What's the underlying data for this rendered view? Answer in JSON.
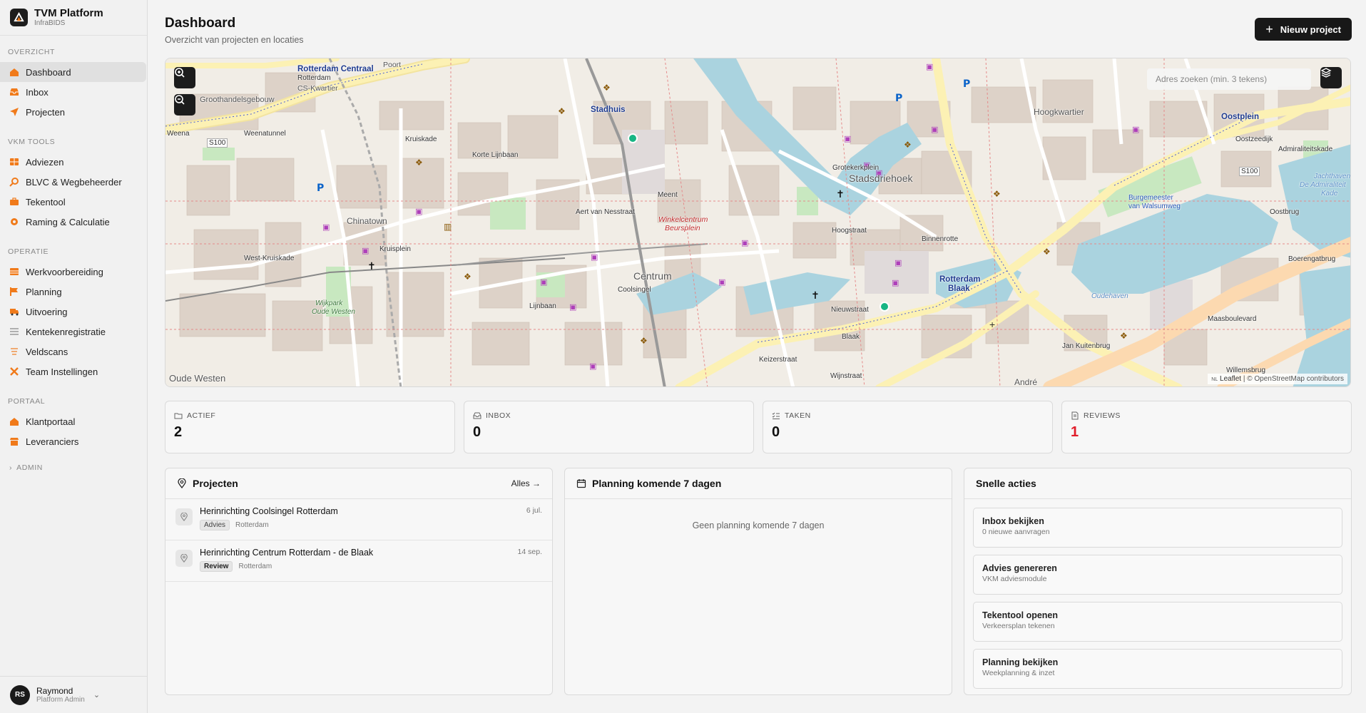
{
  "brand": {
    "title": "TVM Platform",
    "subtitle": "InfraBIDS"
  },
  "sidebar": {
    "sections": [
      {
        "header": "OVERZICHT",
        "items": [
          {
            "label": "Dashboard",
            "icon": "home-icon",
            "active": true
          },
          {
            "label": "Inbox",
            "icon": "inbox-icon"
          },
          {
            "label": "Projecten",
            "icon": "send-icon"
          }
        ]
      },
      {
        "header": "VKM TOOLS",
        "items": [
          {
            "label": "Adviezen",
            "icon": "grid-icon"
          },
          {
            "label": "BLVC & Wegbeheerder",
            "icon": "search-icon"
          },
          {
            "label": "Tekentool",
            "icon": "briefcase-icon"
          },
          {
            "label": "Raming & Calculatie",
            "icon": "gear-icon"
          }
        ]
      },
      {
        "header": "OPERATIE",
        "items": [
          {
            "label": "Werkvoorbereiding",
            "icon": "grid-icon"
          },
          {
            "label": "Planning",
            "icon": "flag-icon"
          },
          {
            "label": "Uitvoering",
            "icon": "truck-icon"
          },
          {
            "label": "Kentekenregistratie",
            "icon": "list-icon"
          },
          {
            "label": "Veldscans",
            "icon": "scan-icon"
          },
          {
            "label": "Team Instellingen",
            "icon": "tools-icon"
          }
        ]
      },
      {
        "header": "PORTAAL",
        "items": [
          {
            "label": "Klantportaal",
            "icon": "home-icon"
          },
          {
            "label": "Leveranciers",
            "icon": "store-icon"
          }
        ]
      }
    ],
    "admin_label": "ADMIN",
    "user": {
      "initials": "RS",
      "name": "Raymond",
      "role": "Platform Admin"
    }
  },
  "header": {
    "title": "Dashboard",
    "subtitle": "Overzicht van projecten en locaties",
    "new_button": "Nieuw project"
  },
  "map": {
    "search_placeholder": "Adres zoeken (min. 3 tekens)",
    "attribution_leaflet": "Leaflet",
    "attribution_osm": "| © OpenStreetMap contributors",
    "attribution_flag": "NL",
    "labels": {
      "rotterdam_centraal": "Rotterdam Centraal",
      "rotterdam_centraal2": "Rotterdam",
      "cs_kwartier": "CS-Kwartier",
      "groothandelsgebouw": "Groothandelsgebouw",
      "stadhuis": "Stadhuis",
      "stadsdriehoek": "Stadsdriehoek",
      "chinatown": "Chinatown",
      "centrum": "Centrum",
      "winkelcentrum": "Winkelcentrum",
      "beursplein": "Beursplein",
      "rotterdam_blaak": "Rotterdam",
      "rotterdam_blaak2": "Blaak",
      "oude_westen": "Oude Westen",
      "hoogkwartier": "Hoogkwartier",
      "wijkpark": "Wijkpark",
      "wijkpark2": "Oude Westen",
      "oostplein": "Oostplein",
      "oudehaven": "Oudehaven",
      "andre": "André",
      "poort": "Poort",
      "jachthaven": "Jachthaven",
      "jachthaven2": "De Admiraliteit",
      "jachthaven3": "Kade",
      "weena": "Weena",
      "weenatunnel": "Weenatunnel",
      "s100a": "S100",
      "s100b": "S100",
      "coolsingel": "Coolsingel",
      "blaak": "Blaak",
      "maasboulevard": "Maasboulevard",
      "boerengatbrug": "Boerengatbrug",
      "hoogstraat": "Hoogstraat",
      "kruisplein": "Kruisplein",
      "oostbrug": "Oostbrug",
      "willemsbrug": "Willemsbrug",
      "jan_kuitenbrug": "Jan Kuitenbrug",
      "west_kruiskade": "West-Kruiskade",
      "lijnbaan": "Lijnbaan",
      "aert_van_nesstraat": "Aert van Nesstraat",
      "korte_lijnbaan": "Korte Lijnbaan",
      "kruiskade": "Kruiskade",
      "meent": "Meent",
      "nieuwstraat": "Nieuwstraat",
      "grotekerkplein": "Grotekerkplein",
      "binnenrotte": "Binnenrotte",
      "admiraliteitskade": "Admiraliteitskade",
      "oostzeedijk": "Oostzeedijk",
      "keizerstraat": "Keizerstraat",
      "wijnstraat": "Wijnstraat",
      "burgemeester": "Burgemeester",
      "van_walsumweg": "van Walsumweg"
    }
  },
  "stats": [
    {
      "label": "ACTIEF",
      "value": "2",
      "icon": "folder-icon"
    },
    {
      "label": "INBOX",
      "value": "0",
      "icon": "inbox-icon"
    },
    {
      "label": "TAKEN",
      "value": "0",
      "icon": "checklist-icon"
    },
    {
      "label": "REVIEWS",
      "value": "1",
      "icon": "document-icon",
      "color": "#e11d2a"
    }
  ],
  "projects": {
    "title": "Projecten",
    "all_label": "Alles →",
    "items": [
      {
        "title": "Herinrichting Coolsingel Rotterdam",
        "tag": "Advies",
        "city": "Rotterdam",
        "date": "6 jul."
      },
      {
        "title": "Herinrichting Centrum Rotterdam - de Blaak",
        "tag": "Review",
        "city": "Rotterdam",
        "date": "14 sep."
      }
    ]
  },
  "planning": {
    "title": "Planning komende 7 dagen",
    "empty": "Geen planning komende 7 dagen"
  },
  "actions": {
    "title": "Snelle acties",
    "items": [
      {
        "title": "Inbox bekijken",
        "sub": "0 nieuwe aanvragen"
      },
      {
        "title": "Advies genereren",
        "sub": "VKM adviesmodule"
      },
      {
        "title": "Tekentool openen",
        "sub": "Verkeersplan tekenen"
      },
      {
        "title": "Planning bekijken",
        "sub": "Weekplanning & inzet"
      }
    ]
  },
  "colors": {
    "accent": "#f07a1a",
    "dark": "#181818",
    "danger": "#e11d2a"
  }
}
